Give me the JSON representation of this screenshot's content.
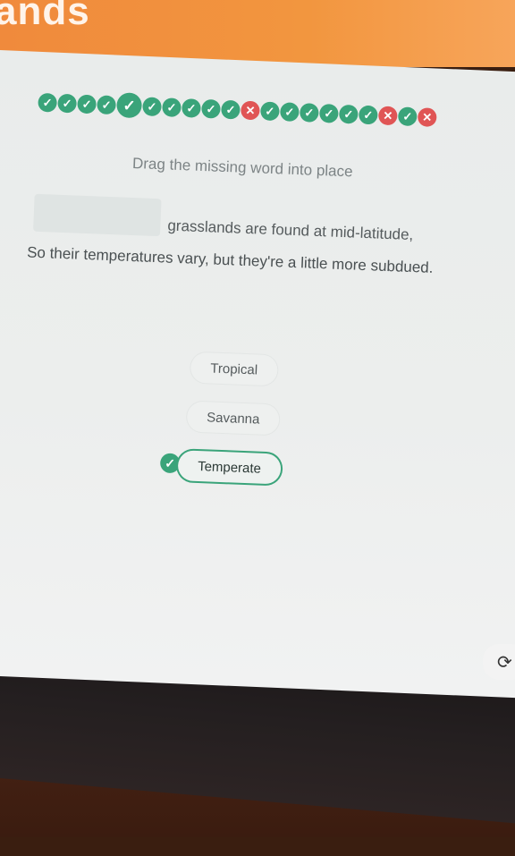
{
  "header": {
    "title": "ands"
  },
  "progress": {
    "steps": [
      {
        "status": "correct",
        "icon": "check-icon"
      },
      {
        "status": "correct",
        "icon": "check-icon"
      },
      {
        "status": "correct",
        "icon": "check-icon"
      },
      {
        "status": "correct",
        "icon": "check-icon"
      },
      {
        "status": "current",
        "icon": "check-icon"
      },
      {
        "status": "correct",
        "icon": "check-icon"
      },
      {
        "status": "correct",
        "icon": "check-icon"
      },
      {
        "status": "correct",
        "icon": "check-icon"
      },
      {
        "status": "correct",
        "icon": "check-icon"
      },
      {
        "status": "correct",
        "icon": "check-icon"
      },
      {
        "status": "wrong",
        "icon": "cross-icon"
      },
      {
        "status": "correct",
        "icon": "check-icon"
      },
      {
        "status": "correct",
        "icon": "check-icon"
      },
      {
        "status": "correct",
        "icon": "check-icon"
      },
      {
        "status": "correct",
        "icon": "check-icon"
      },
      {
        "status": "correct",
        "icon": "check-icon"
      },
      {
        "status": "correct",
        "icon": "check-icon"
      },
      {
        "status": "wrong",
        "icon": "cross-icon"
      },
      {
        "status": "correct",
        "icon": "check-icon"
      },
      {
        "status": "wrong",
        "icon": "cross-icon"
      }
    ]
  },
  "exercise": {
    "instruction": "Drag the missing word into place",
    "sentence_line1": "grasslands are found at mid-latitude,",
    "sentence_line2": "So their temperatures vary, but they're a little more subdued."
  },
  "options": [
    {
      "label": "Tropical",
      "selected": false
    },
    {
      "label": "Savanna",
      "selected": false
    },
    {
      "label": "Temperate",
      "selected": true
    }
  ],
  "colors": {
    "accent": "#3aa47a",
    "error": "#e05555",
    "header": "#f08a3c"
  }
}
